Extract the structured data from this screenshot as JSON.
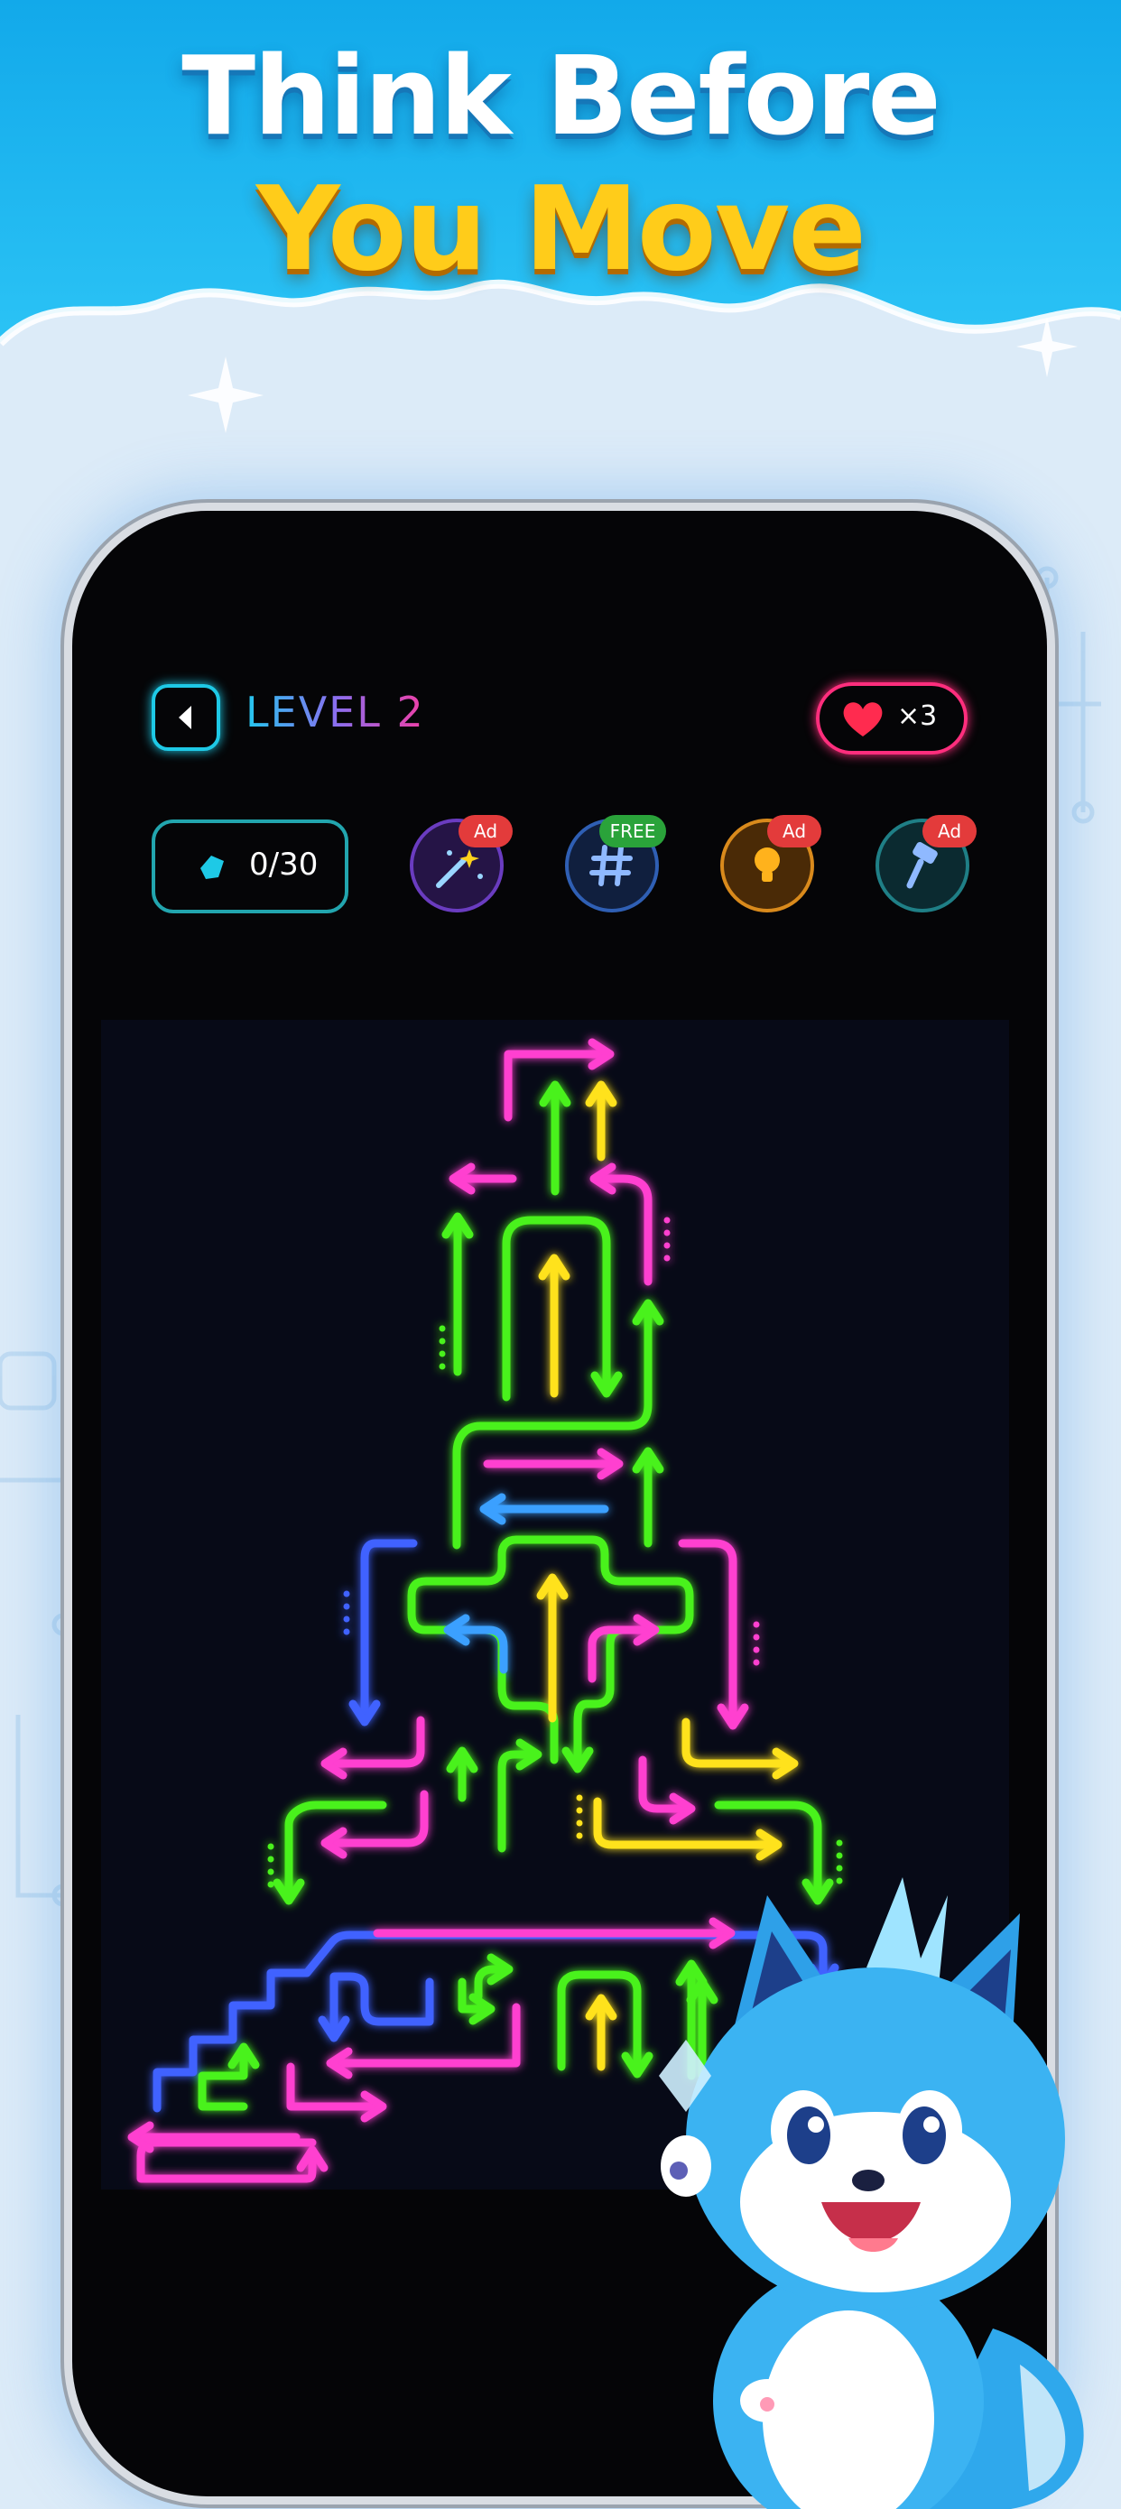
{
  "headline": {
    "line1": "Think Before",
    "line2": "You Move"
  },
  "header": {
    "level_label": "LEVEL 2",
    "lives": "×3"
  },
  "toolbar": {
    "gems": "0/30",
    "tools": [
      {
        "name": "magic-wand",
        "badge": "Ad",
        "badge_color": "#e33b3b",
        "ring": "#6a3cc0"
      },
      {
        "name": "grid",
        "badge": "FREE",
        "badge_color": "#2aa33a",
        "ring": "#2f5fb4"
      },
      {
        "name": "lightbulb",
        "badge": "Ad",
        "badge_color": "#e33b3b",
        "ring": "#d98a1c"
      },
      {
        "name": "hammer",
        "badge": "Ad",
        "badge_color": "#e33b3b",
        "ring": "#1f7f86"
      }
    ]
  },
  "colors": {
    "magenta": "#ff3fd0",
    "green": "#49f21f",
    "yellow": "#ffe21c",
    "blue": "#3f62ff",
    "lightblue": "#3aa0ff",
    "pink": "#ff3f9f",
    "header_blue": "#18b6ef"
  },
  "mascot": "blue-fox-mascot"
}
